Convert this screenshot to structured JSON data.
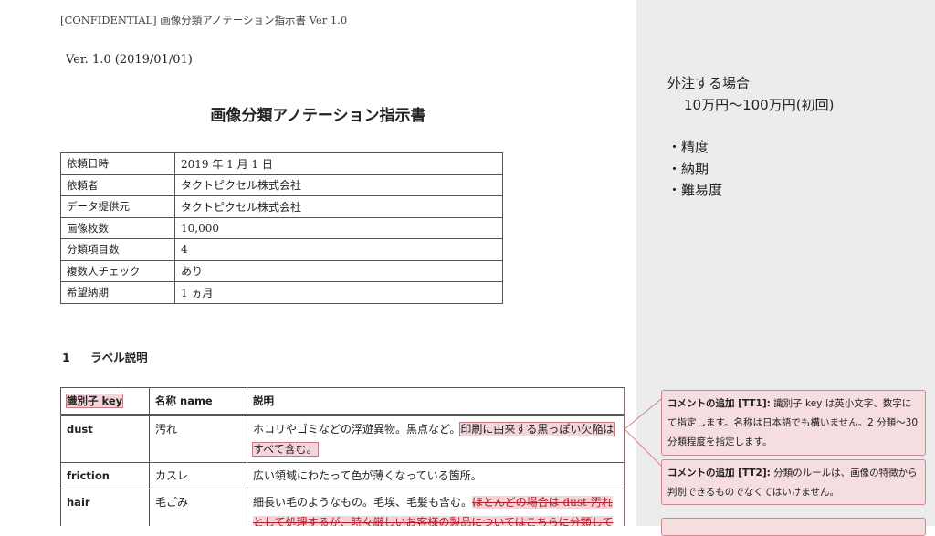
{
  "document": {
    "header": "[CONFIDENTIAL]  画像分類アノテーション指示書  Ver 1.0",
    "version_line": "Ver. 1.0 (2019/01/01)",
    "title": "画像分類アノテーション指示書",
    "info_table": [
      {
        "key": "依頼日時",
        "value": "2019 年 1 月 1 日"
      },
      {
        "key": "依頼者",
        "value": "タクトピクセル株式会社"
      },
      {
        "key": "データ提供元",
        "value": "タクトピクセル株式会社"
      },
      {
        "key": "画像枚数",
        "value": "10,000"
      },
      {
        "key": "分類項目数",
        "value": "4"
      },
      {
        "key": "複数人チェック",
        "value": "あり"
      },
      {
        "key": "希望納期",
        "value": "1 ヵ月"
      }
    ],
    "section": {
      "number": "1",
      "title": "ラベル説明"
    },
    "label_table": {
      "headers": [
        "識別子 key",
        "名称 name",
        "説明"
      ],
      "rows": [
        {
          "key": "dust",
          "name": "汚れ",
          "desc_plain": "ホコリやゴミなどの浮遊異物。黒点など。",
          "desc_highlight": "印刷に由来する黒っぽい欠陥はすべて含む。"
        },
        {
          "key": "friction",
          "name": "カスレ",
          "desc_plain": "広い領域にわたって色が薄くなっている箇所。",
          "desc_highlight": ""
        },
        {
          "key": "hair",
          "name": "毛ごみ",
          "desc_plain": "細長い毛のようなもの。毛埃、毛髪も含む。",
          "desc_strike": "ほとんどの場合は dust 汚れとして処理するが、時々厳しいお客様の製品についてはこちらに分類している。"
        }
      ]
    }
  },
  "notes": {
    "heading": "外注する場合",
    "price": "10万円〜100万円(初回)",
    "bullets": [
      "・精度",
      "・納期",
      "・難易度"
    ]
  },
  "comments": [
    {
      "label": "コメントの追加 [TT1]:",
      "text": "識別子 key は英小文字、数字にて指定します。名称は日本語でも構いません。2 分類〜30 分類程度を指定します。"
    },
    {
      "label": "コメントの追加 [TT2]:",
      "text": "分類のルールは、画像の特徴から判別できるものでなくてはいけません。"
    }
  ]
}
